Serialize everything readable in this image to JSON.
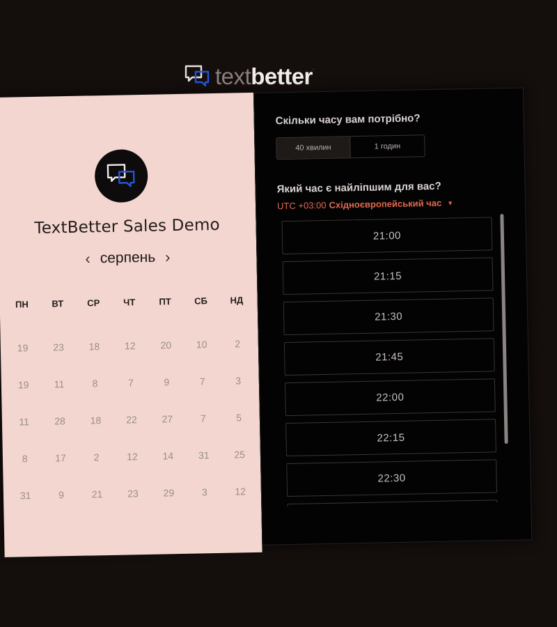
{
  "brand": {
    "logo_light": "text",
    "logo_bold": "better",
    "logo_mark": "."
  },
  "left": {
    "company": "TextBetter Sales Demo",
    "month": "серпень",
    "prev": "‹",
    "next": "›",
    "weekdays": [
      "ПН",
      "ВТ",
      "СР",
      "ЧТ",
      "ПТ",
      "СБ",
      "НД"
    ],
    "days": [
      [
        "19",
        "23",
        "18",
        "12",
        "20",
        "10",
        "2"
      ],
      [
        "19",
        "11",
        "8",
        "7",
        "9",
        "7",
        "3"
      ],
      [
        "11",
        "28",
        "18",
        "22",
        "27",
        "7",
        "5"
      ],
      [
        "8",
        "17",
        "2",
        "12",
        "14",
        "31",
        "25"
      ],
      [
        "31",
        "9",
        "21",
        "23",
        "29",
        "3",
        "12"
      ]
    ]
  },
  "right": {
    "duration_question": "Скільки часу вам потрібно?",
    "durations": [
      "40 хвилин",
      "1 годин"
    ],
    "time_question": "Який час є найліпшим для вас?",
    "tz_offset": "UTC +03:00",
    "tz_name": "Східноєвропейський час",
    "tz_caret": "▼",
    "slots": [
      "21:00",
      "21:15",
      "21:30",
      "21:45",
      "22:00",
      "22:15",
      "22:30",
      ""
    ]
  },
  "colors": {
    "accent": "#e2694f",
    "left_bg": "#f3d6cf",
    "right_bg": "#030303",
    "icon_blue": "#2456d6"
  }
}
